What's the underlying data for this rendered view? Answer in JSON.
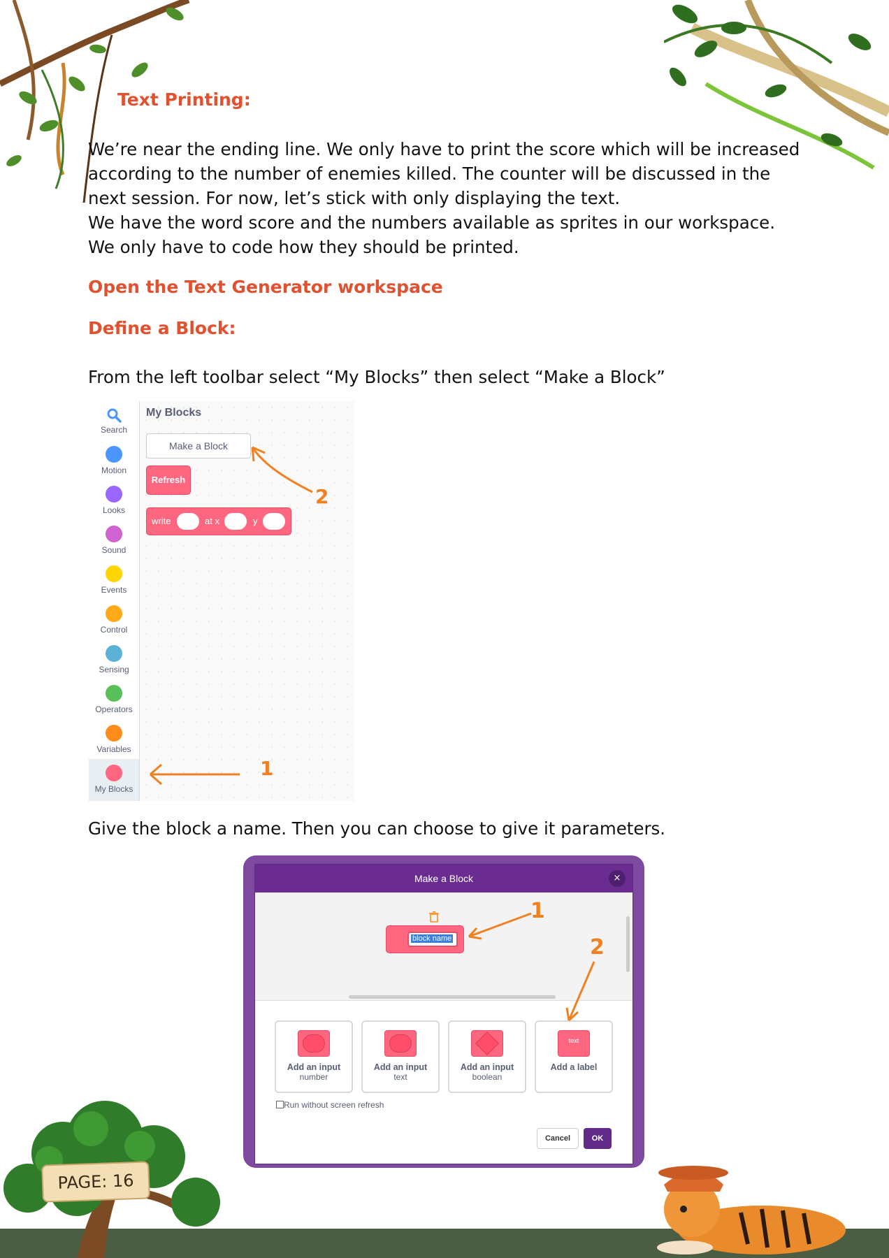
{
  "section": {
    "heading": "Text Printing:",
    "para1": "We’re near the ending line. We only have to print the score which will be increased according to the number of enemies killed. The counter will be discussed in the next session. For now, let’s stick with only displaying the text.",
    "para2": "We have the word score and the numbers available as sprites in our workspace. We only have to code how they should be printed."
  },
  "open_workspace": "Open the Text Generator workspace",
  "define_heading": "Define a Block:",
  "instruction1": "From the left toolbar select “My Blocks” then select “Make a Block”",
  "instruction2": "Give the block a name. Then you can choose to give it parameters.",
  "palette": {
    "categories": [
      {
        "label": "Search",
        "color": "#4c97ff"
      },
      {
        "label": "Motion",
        "color": "#4c97ff"
      },
      {
        "label": "Looks",
        "color": "#9966ff"
      },
      {
        "label": "Sound",
        "color": "#cf63cf"
      },
      {
        "label": "Events",
        "color": "#ffd500"
      },
      {
        "label": "Control",
        "color": "#ffab19"
      },
      {
        "label": "Sensing",
        "color": "#5cb1d6"
      },
      {
        "label": "Operators",
        "color": "#59c059"
      },
      {
        "label": "Variables",
        "color": "#ff8c1a"
      },
      {
        "label": "My Blocks",
        "color": "#ff6680"
      }
    ],
    "flyout_title": "My Blocks",
    "make_block": "Make a Block",
    "refresh_block": "Refresh",
    "write_block": {
      "write": "write",
      "at_x": "at x",
      "y": "y"
    },
    "callout1": "1",
    "callout2": "2"
  },
  "dialog": {
    "title": "Make a Block",
    "close": "×",
    "block_name": "block name",
    "options": [
      {
        "label": "Add an input",
        "sub": "number"
      },
      {
        "label": "Add an input",
        "sub": "text"
      },
      {
        "label": "Add an input",
        "sub": "boolean"
      },
      {
        "label": "Add a label",
        "sub": "",
        "icon_text": "text"
      }
    ],
    "checkbox_label": "Run without screen refresh",
    "cancel": "Cancel",
    "ok": "OK",
    "callout1": "1",
    "callout2": "2"
  },
  "page_label": "PAGE: 16"
}
